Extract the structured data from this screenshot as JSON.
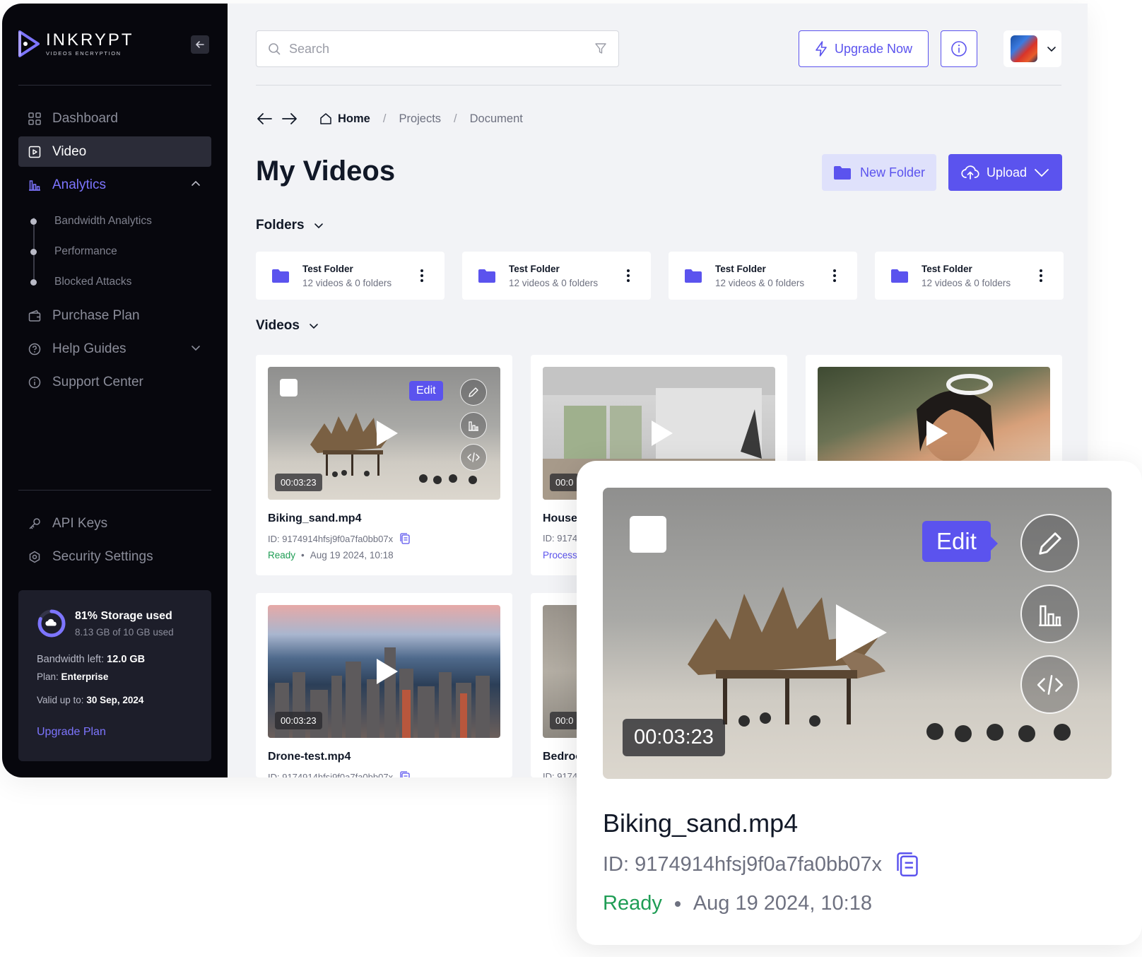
{
  "colors": {
    "accent": "#5b53ee",
    "sidebar_bg": "#07070d",
    "ready": "#1f9d55",
    "main_bg": "#f2f3f6"
  },
  "brand": {
    "name": "INKRYPT",
    "tagline": "VIDEOS ENCRYPTION"
  },
  "sidebar": {
    "nav": [
      {
        "label": "Dashboard",
        "icon": "grid-icon"
      },
      {
        "label": "Video",
        "icon": "video-icon",
        "active": true
      },
      {
        "label": "Analytics",
        "icon": "bar-chart-icon",
        "expanded": true
      }
    ],
    "analytics_sub": [
      {
        "label": "Bandwidth Analytics"
      },
      {
        "label": "Performance"
      },
      {
        "label": "Blocked Attacks"
      }
    ],
    "nav2": [
      {
        "label": "Purchase Plan",
        "icon": "wallet-icon"
      },
      {
        "label": "Help Guides",
        "icon": "help-circle-icon"
      },
      {
        "label": "Support Center",
        "icon": "info-circle-icon"
      }
    ],
    "bottom": [
      {
        "label": "API Keys",
        "icon": "key-icon"
      },
      {
        "label": "Security Settings",
        "icon": "shield-gear-icon"
      }
    ],
    "storage": {
      "percent_used": 81,
      "title": "81% Storage used",
      "sub": "8.13 GB of 10 GB used",
      "bandwidth_label": "Bandwidth left:",
      "bandwidth_value": "12.0 GB",
      "plan_label": "Plan:",
      "plan_value": "Enterprise",
      "valid_label": "Valid up to:",
      "valid_value": "30 Sep, 2024",
      "upgrade_link": "Upgrade Plan"
    }
  },
  "header": {
    "search_placeholder": "Search",
    "upgrade_label": "Upgrade Now"
  },
  "breadcrumb": {
    "home": "Home",
    "items": [
      "Projects",
      "Document"
    ]
  },
  "page": {
    "title": "My Videos",
    "new_folder_label": "New Folder",
    "upload_label": "Upload"
  },
  "folders": {
    "heading": "Folders",
    "items": [
      {
        "name": "Test Folder",
        "meta": "12 videos & 0 folders"
      },
      {
        "name": "Test Folder",
        "meta": "12 videos & 0 folders"
      },
      {
        "name": "Test Folder",
        "meta": "12 videos & 0 folders"
      },
      {
        "name": "Test Folder",
        "meta": "12 videos & 0 folders"
      }
    ]
  },
  "videos": {
    "heading": "Videos",
    "items": [
      {
        "name": "Biking_sand.mp4",
        "id": "ID: 9174914hfsj9f0a7fa0bb07x",
        "status": "Ready",
        "date": "Aug 19 2024, 10:18",
        "duration": "00:03:23",
        "edit_label": "Edit"
      },
      {
        "name": "House",
        "id": "ID: 9174",
        "status": "Process",
        "duration": "00:0"
      },
      {
        "name": "",
        "id": "",
        "status": "",
        "duration": ""
      },
      {
        "name": "Drone-test.mp4",
        "id": "ID: 9174914hfsj9f0a7fa0bb07x",
        "duration": "00:03:23"
      },
      {
        "name": "Bedroo",
        "id": "ID: 9174",
        "duration": "00:0"
      }
    ]
  },
  "popup": {
    "name": "Biking_sand.mp4",
    "id": "ID: 9174914hfsj9f0a7fa0bb07x",
    "status": "Ready",
    "date": "Aug 19 2024, 10:18",
    "duration": "00:03:23",
    "edit_label": "Edit"
  }
}
